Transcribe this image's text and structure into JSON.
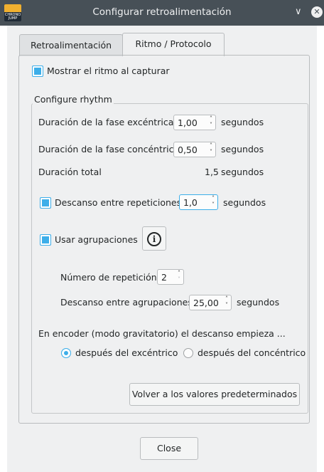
{
  "window": {
    "title": "Configurar retroalimentación",
    "app_icon": "chronojump-logo",
    "logo_text": "CHRONO JUMP"
  },
  "tabs": [
    {
      "label": "Retroalimentación",
      "active": false
    },
    {
      "label": "Ritmo / Protocolo",
      "active": true
    }
  ],
  "show_rhythm": {
    "label": "Mostrar el ritmo al capturar",
    "checked": true
  },
  "rhythm_group": {
    "title": "Configure rhythm",
    "eccentric": {
      "label": "Duración de la fase excéntrica",
      "value": "1,00",
      "unit": "segundos"
    },
    "concentric": {
      "label": "Duración de la fase concéntrica",
      "value": "0,50",
      "unit": "segundos"
    },
    "total": {
      "label": "Duración total",
      "value": "1,5",
      "unit": "segundos"
    },
    "rest_reps": {
      "label": "Descanso entre repeticiones",
      "checked": true,
      "value": "1,0",
      "unit": "segundos"
    },
    "use_clusters": {
      "label": "Usar agrupaciones",
      "checked": true,
      "info_icon": "info-icon"
    },
    "rep_number": {
      "label": "Número de repetición",
      "value": "2"
    },
    "rest_clusters": {
      "label": "Descanso entre agrupaciones",
      "value": "25,00",
      "unit": "segundos"
    },
    "encoder_rest_label": "En encoder (modo gravitatorio) el descanso empieza ...",
    "radio_after_eccentric": {
      "label": "después del excéntrico",
      "selected": true
    },
    "radio_after_concentric": {
      "label": "después del concéntrico",
      "selected": false
    },
    "reset_button": "Volver a los valores predeterminados"
  },
  "close_button": "Close",
  "colors": {
    "accent": "#3daee9",
    "titlebar": "#475057",
    "background": "#eff0f1"
  }
}
